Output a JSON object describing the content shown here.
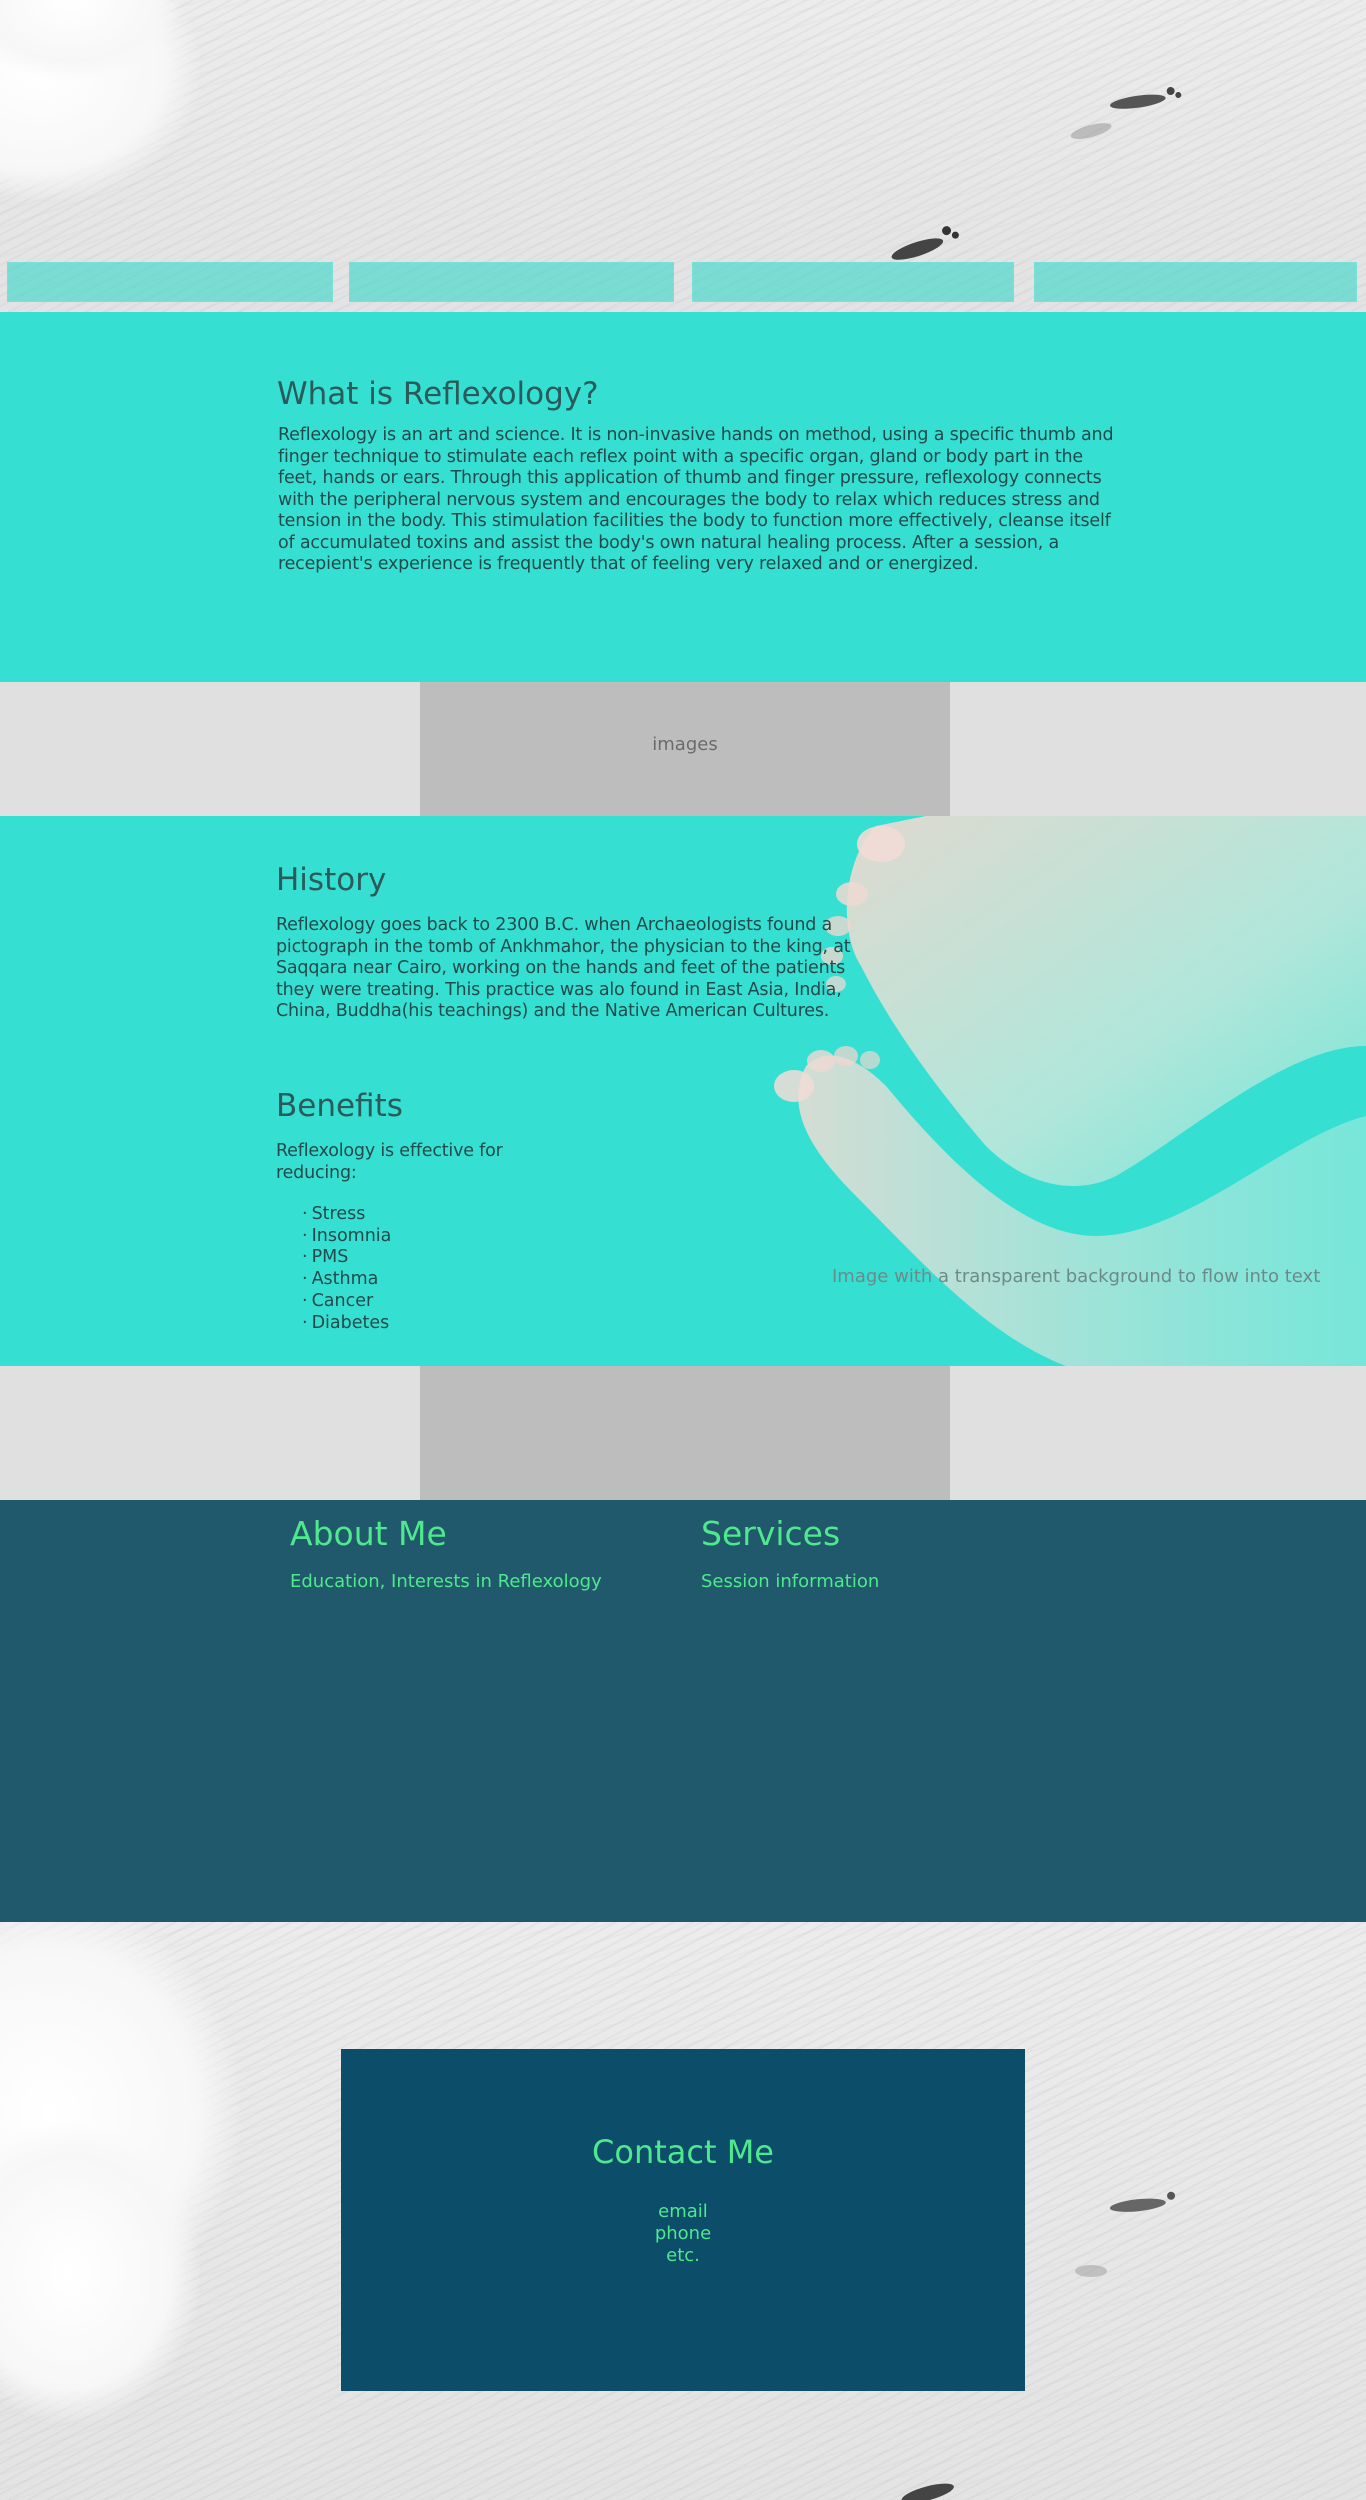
{
  "nav": {
    "items": [
      "",
      "",
      "",
      ""
    ]
  },
  "what": {
    "title": "What is Reflexology?",
    "body": "Reflexology is an art and science. It is non-invasive hands on method, using a specific thumb and finger technique to stimulate each reflex point  with a specific organ, gland or body part in the feet, hands or ears. Through this application of thumb and finger pressure, reflexology connects with the peripheral nervous system and encourages the body to relax which reduces stress and tension in the body. This stimulation facilities the body to function more effectively, cleanse itself of accumulated toxins and assist the body's own natural healing process. After a session, a recepient's experience is frequently that of feeling very relaxed and or energized."
  },
  "images_band": {
    "label": "images"
  },
  "history": {
    "title": "History",
    "body": "Reflexology goes back to 2300 B.C. when Archaeologists found a pictograph in the tomb of Ankhmahor, the physician to the king, at Saqqara near Cairo, working on the hands and feet of the patients they were treating. This practice was alo found in East Asia, India, China, Buddha(his teachings) and the Native American Cultures."
  },
  "benefits": {
    "title": "Benefits",
    "intro": "Reflexology is effective for reducing:",
    "items": [
      "Stress",
      "Insomnia",
      "PMS",
      "Asthma",
      "Cancer",
      "Diabetes"
    ]
  },
  "feet_image": {
    "caption": "Image with a transparent background to flow into text"
  },
  "about": {
    "title": "About Me",
    "text": "Education, Interests in Reflexology"
  },
  "services": {
    "title": "Services",
    "text": "Session information"
  },
  "contact": {
    "title": "Contact Me",
    "lines": [
      "email",
      "phone",
      "etc."
    ]
  },
  "colors": {
    "teal": "#35e0d3",
    "dark_teal": "#1f596b",
    "contact_blue": "#0c4d6a",
    "accent_green": "#4fe88e",
    "gray_band": "#e0e0e0",
    "gray_box": "#bdbdbd"
  }
}
